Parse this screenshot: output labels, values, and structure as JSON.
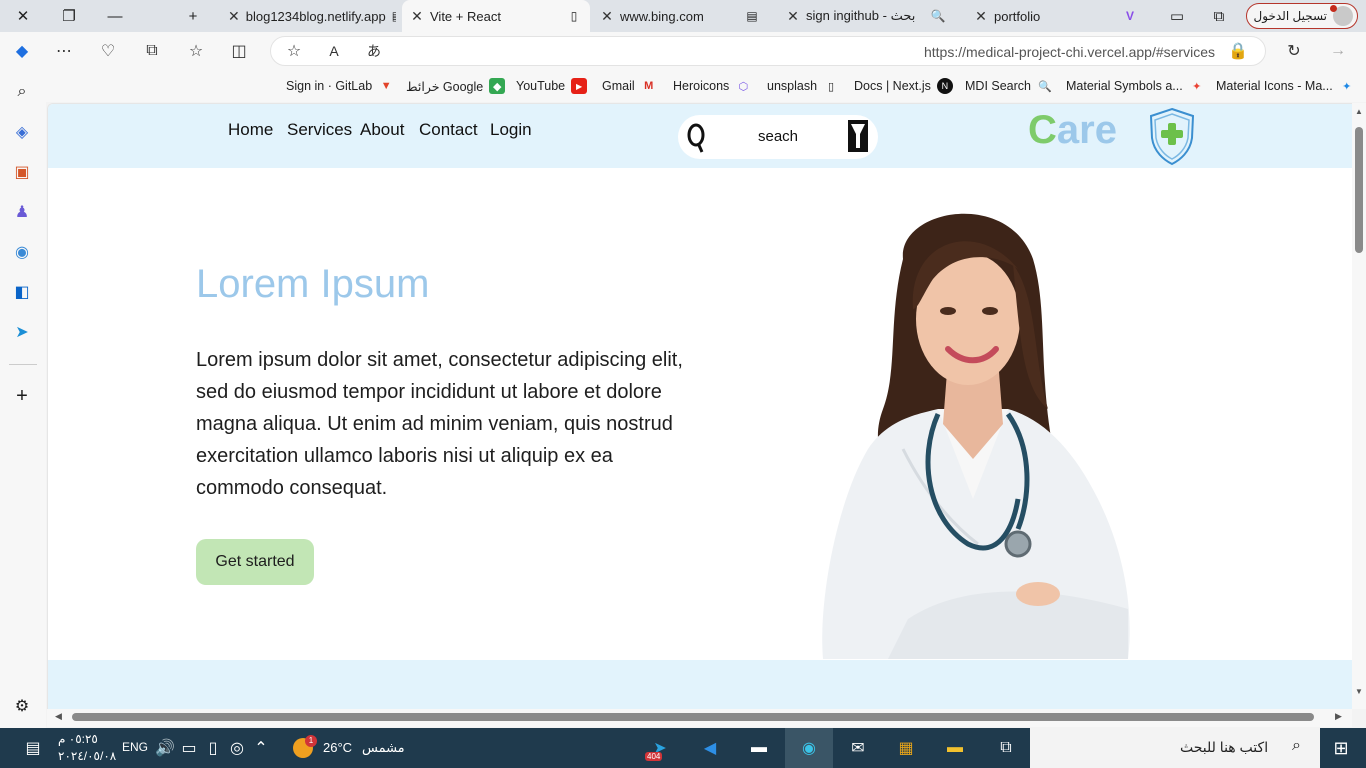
{
  "browser": {
    "tabs": [
      {
        "title": "blog1234blog.netlify.app",
        "active": false
      },
      {
        "title": "Vite + React",
        "active": true
      },
      {
        "title": "www.bing.com",
        "active": false
      },
      {
        "title": "sign ingithub - بحث",
        "active": false
      },
      {
        "title": "portfolio",
        "active": false
      }
    ],
    "signin_label": "تسجيل الدخول",
    "url": "https://medical-project-chi.vercel.app/#services",
    "bookmarks": [
      {
        "label": "Sign in · GitLab"
      },
      {
        "label": "خرائط Google"
      },
      {
        "label": "YouTube"
      },
      {
        "label": "Gmail"
      },
      {
        "label": "Heroicons"
      },
      {
        "label": "unsplash"
      },
      {
        "label": "Docs | Next.js"
      },
      {
        "label": "MDI Search"
      },
      {
        "label": "Material Symbols a..."
      },
      {
        "label": "Material Icons - Ma..."
      }
    ],
    "sidebar_icons": [
      "search-icon",
      "tag-icon",
      "toolbox-icon",
      "games-icon",
      "office-icon",
      "outlook-icon",
      "telegram-icon",
      "add-icon",
      "settings-icon"
    ]
  },
  "site": {
    "nav": [
      "Home",
      "Services",
      "About",
      "Contact",
      "Login"
    ],
    "search_text": "seach",
    "brand": {
      "first": "C",
      "rest": "are"
    },
    "hero": {
      "title": "Lorem Ipsum",
      "text": "Lorem ipsum dolor sit amet, consectetur adipiscing elit, sed do eiusmod tempor incididunt ut labore et dolore magna aliqua. Ut enim ad minim veniam, quis nostrud exercitation ullamco laboris nisi ut aliquip ex ea commodo consequat.",
      "cta": "Get started"
    },
    "colors": {
      "accent_blue": "#9cc8ea",
      "accent_green": "#7ecb6b",
      "header_bg": "#e2f3fc",
      "button_bg": "#c2e6b5"
    }
  },
  "taskbar": {
    "search_placeholder": "اكتب هنا للبحث",
    "weather": {
      "temp": "26°C",
      "condition": "مشمس",
      "badge": "1"
    },
    "lang": "ENG",
    "time": "٠٥:٢٥ م",
    "date": "٢٠٢٤/٠٥/٠٨",
    "telegram_badge": "404"
  }
}
